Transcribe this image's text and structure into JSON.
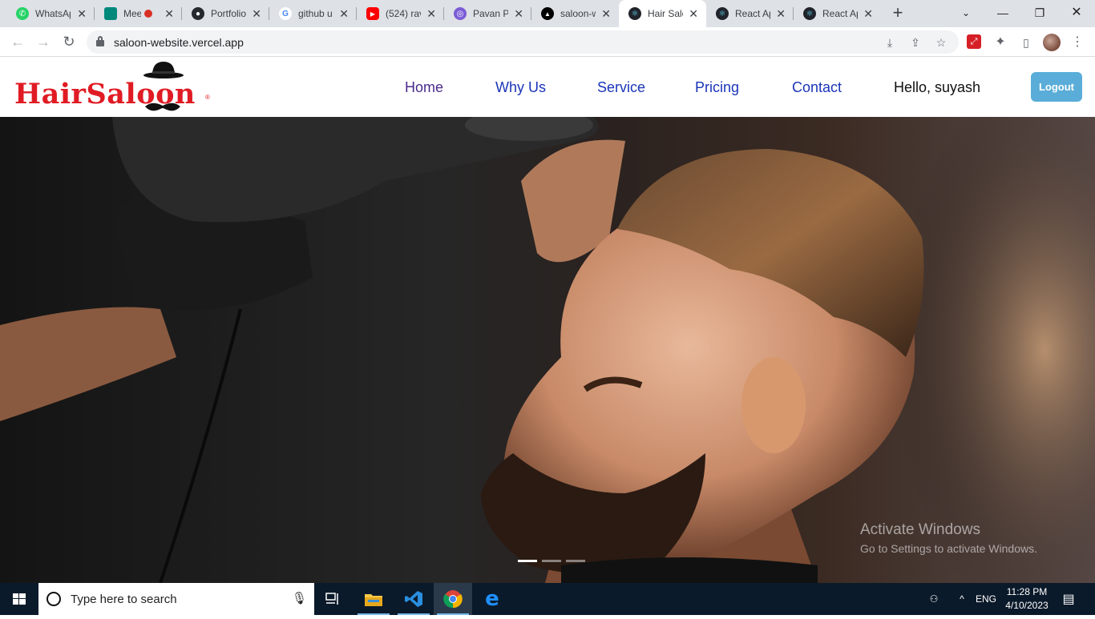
{
  "browser": {
    "tabs": [
      {
        "title": "WhatsApp",
        "favicon": "whatsapp-icon",
        "color": "#25d366"
      },
      {
        "title": "Meet",
        "favicon": "google-meet-icon",
        "color": "#00897b"
      },
      {
        "title": "Portfolio",
        "favicon": "github-icon",
        "color": "#24292e"
      },
      {
        "title": "github u",
        "favicon": "google-icon",
        "color": "#4285f4"
      },
      {
        "title": "(524) rav",
        "favicon": "youtube-icon",
        "color": "#ff0000"
      },
      {
        "title": "Pavan Pa",
        "favicon": "portfolio-icon",
        "color": "#7b5cd6"
      },
      {
        "title": "saloon-w",
        "favicon": "vercel-icon",
        "color": "#000000"
      },
      {
        "title": "Hair Salo",
        "favicon": "react-icon",
        "color": "#20232a"
      },
      {
        "title": "React Ap",
        "favicon": "react-icon",
        "color": "#20232a"
      },
      {
        "title": "React Ap",
        "favicon": "react-icon",
        "color": "#20232a"
      }
    ],
    "url": "saloon-website.vercel.app"
  },
  "site": {
    "logo_text": "HairSaloon",
    "nav": [
      "Home",
      "Why Us",
      "Service",
      "Pricing",
      "Contact"
    ],
    "greeting": "Hello, suyash",
    "logout_label": "Logout",
    "brand_color": "#e01b24",
    "link_color": "#1a35b8",
    "button_color": "#5aadd8"
  },
  "hero": {
    "slide_count": 3,
    "active_slide": 1
  },
  "watermark": {
    "line1": "Activate Windows",
    "line2": "Go to Settings to activate Windows."
  },
  "taskbar": {
    "search_placeholder": "Type here to search",
    "language": "ENG",
    "time": "11:28 PM",
    "date": "4/10/2023"
  }
}
